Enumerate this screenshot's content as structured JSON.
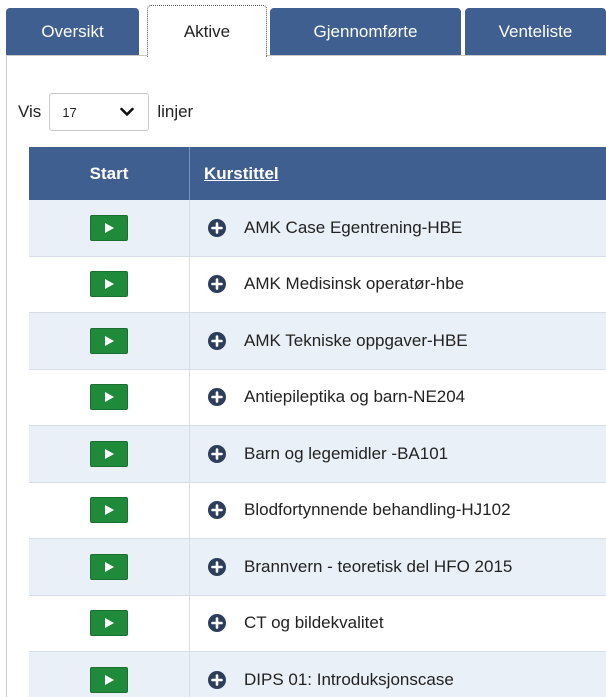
{
  "tabs": [
    {
      "label": "Oversikt",
      "active": false
    },
    {
      "label": "Aktive",
      "active": true
    },
    {
      "label": "Gjennomførte",
      "active": false
    },
    {
      "label": "Venteliste",
      "active": false
    }
  ],
  "show_rows": {
    "prefix": "Vis",
    "value": "17",
    "suffix": "linjer"
  },
  "table": {
    "headers": {
      "start": "Start",
      "title": "Kurstittel"
    },
    "rows": [
      {
        "title": "AMK Case Egentrening-HBE"
      },
      {
        "title": "AMK Medisinsk operatør-hbe"
      },
      {
        "title": "AMK Tekniske oppgaver-HBE"
      },
      {
        "title": "Antiepileptika og barn-NE204"
      },
      {
        "title": "Barn og legemidler -BA101"
      },
      {
        "title": "Blodfortynnende behandling-HJ102"
      },
      {
        "title": "Brannvern - teoretisk del HFO 2015"
      },
      {
        "title": "CT og bildekvalitet"
      },
      {
        "title": "DIPS 01: Introduksjonscase"
      }
    ]
  },
  "colors": {
    "header_blue": "#3e5f8f",
    "row_alt": "#eaf0f7",
    "play_green": "#1f8a3a"
  }
}
